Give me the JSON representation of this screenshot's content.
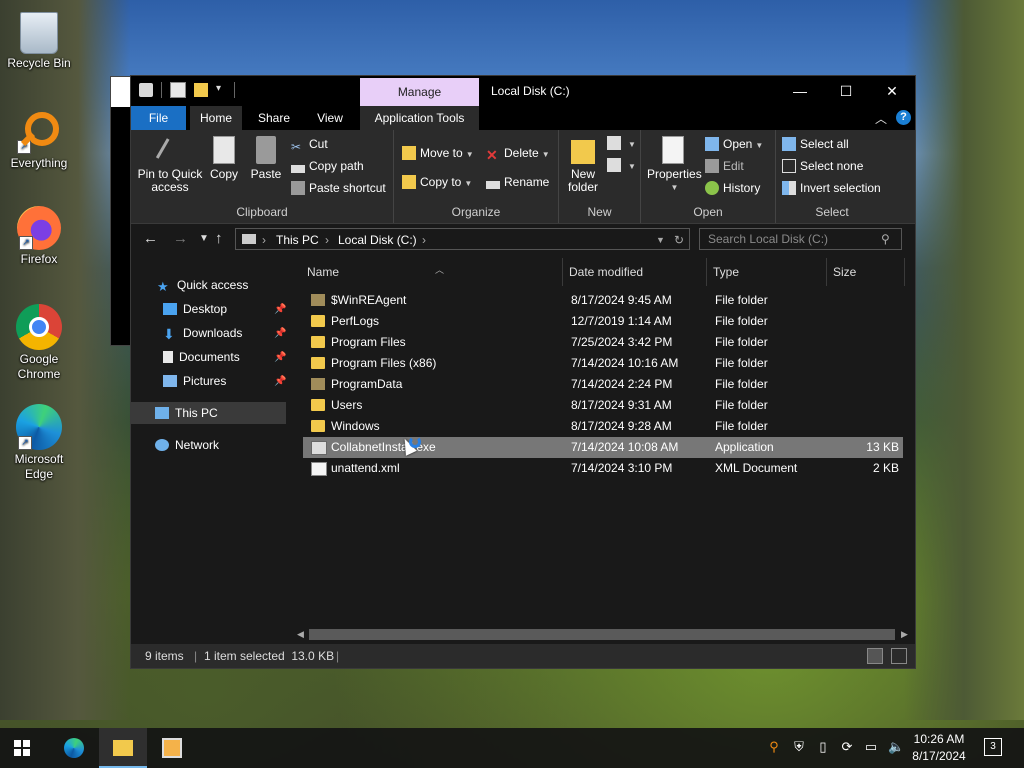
{
  "desktop": {
    "icons": [
      {
        "label": "Recycle Bin",
        "icon": "recycle-bin-icon"
      },
      {
        "label": "Everything",
        "icon": "everything-icon"
      },
      {
        "label": "Firefox",
        "icon": "firefox-icon"
      },
      {
        "label": "Google Chrome",
        "icon": "chrome-icon"
      },
      {
        "label": "Microsoft Edge",
        "icon": "edge-icon"
      }
    ]
  },
  "window": {
    "title": "Local Disk (C:)",
    "contextual_tab_header": "Manage",
    "controls": {
      "minimize": "—",
      "maximize": "☐",
      "close": "✕"
    },
    "tabs": {
      "file": "File",
      "home": "Home",
      "share": "Share",
      "view": "View",
      "app_tools": "Application Tools"
    },
    "help": "?"
  },
  "ribbon": {
    "clipboard": {
      "label": "Clipboard",
      "pin": "Pin to Quick access",
      "copy": "Copy",
      "paste": "Paste",
      "cut": "Cut",
      "copy_path": "Copy path",
      "paste_shortcut": "Paste shortcut"
    },
    "organize": {
      "label": "Organize",
      "move_to": "Move to",
      "copy_to": "Copy to",
      "delete": "Delete",
      "rename": "Rename"
    },
    "new": {
      "label": "New",
      "new_folder": "New folder"
    },
    "open": {
      "label": "Open",
      "properties": "Properties",
      "open": "Open",
      "edit": "Edit",
      "history": "History"
    },
    "select": {
      "label": "Select",
      "select_all": "Select all",
      "select_none": "Select none",
      "invert": "Invert selection"
    }
  },
  "address": {
    "breadcrumb": [
      "This PC",
      "Local Disk (C:)"
    ],
    "search_placeholder": "Search Local Disk (C:)"
  },
  "nav": {
    "quick_access": "Quick access",
    "desktop": "Desktop",
    "downloads": "Downloads",
    "documents": "Documents",
    "pictures": "Pictures",
    "this_pc": "This PC",
    "network": "Network"
  },
  "columns": {
    "name": "Name",
    "date": "Date modified",
    "type": "Type",
    "size": "Size"
  },
  "files": [
    {
      "name": "$WinREAgent",
      "date": "8/17/2024 9:45 AM",
      "type": "File folder",
      "size": "",
      "kind": "folder-hidden"
    },
    {
      "name": "PerfLogs",
      "date": "12/7/2019 1:14 AM",
      "type": "File folder",
      "size": "",
      "kind": "folder"
    },
    {
      "name": "Program Files",
      "date": "7/25/2024 3:42 PM",
      "type": "File folder",
      "size": "",
      "kind": "folder"
    },
    {
      "name": "Program Files (x86)",
      "date": "7/14/2024 10:16 AM",
      "type": "File folder",
      "size": "",
      "kind": "folder"
    },
    {
      "name": "ProgramData",
      "date": "7/14/2024 2:24 PM",
      "type": "File folder",
      "size": "",
      "kind": "folder-hidden"
    },
    {
      "name": "Users",
      "date": "8/17/2024 9:31 AM",
      "type": "File folder",
      "size": "",
      "kind": "folder"
    },
    {
      "name": "Windows",
      "date": "8/17/2024 9:28 AM",
      "type": "File folder",
      "size": "",
      "kind": "folder"
    },
    {
      "name": "CollabnetInstall.exe",
      "date": "7/14/2024 10:08 AM",
      "type": "Application",
      "size": "13 KB",
      "kind": "app",
      "selected": true
    },
    {
      "name": "unattend.xml",
      "date": "7/14/2024 3:10 PM",
      "type": "XML Document",
      "size": "2 KB",
      "kind": "xml"
    }
  ],
  "status": {
    "count": "9 items",
    "selection": "1 item selected  13.0 KB"
  },
  "taskbar": {
    "time": "10:26 AM",
    "date": "8/17/2024",
    "notifications": "3"
  }
}
